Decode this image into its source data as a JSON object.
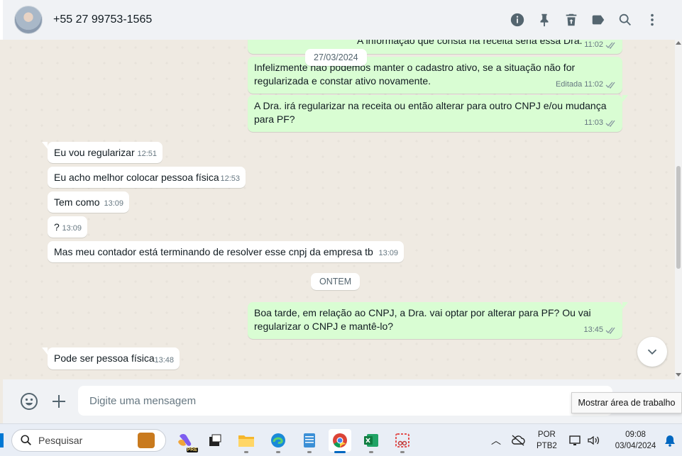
{
  "header": {
    "contact_name": "+55 27 99753-1565",
    "actions": [
      "info-icon",
      "pin-icon",
      "delete-icon",
      "label-icon",
      "search-icon",
      "menu-icon"
    ]
  },
  "chat": {
    "top_partial": {
      "text": "A informação que consta na receita seria essa Dra.",
      "time": "11:02"
    },
    "date_pill_1": "27/03/2024",
    "messages": [
      {
        "dir": "out",
        "text": "Infelizmente não podemos manter o cadastro ativo, se a situação não for regularizada e constar ativo novamente.",
        "edited": "Editada",
        "time": "11:02"
      },
      {
        "dir": "out",
        "text": "A Dra. irá regularizar na receita ou então alterar para outro CNPJ e/ou mudança para PF?",
        "time": "11:03"
      },
      {
        "dir": "in",
        "text": "Eu vou regularizar",
        "time": "12:51"
      },
      {
        "dir": "in",
        "text": "Eu acho melhor colocar pessoa física",
        "time": "12:53"
      },
      {
        "dir": "in",
        "text": "Tem como",
        "time": "13:09"
      },
      {
        "dir": "in",
        "text": "?",
        "time": "13:09"
      },
      {
        "dir": "in",
        "text": "Mas meu contador está terminando de resolver esse cnpj da empresa tb",
        "time": "13:09"
      },
      {
        "dir": "out",
        "text": "Boa tarde, em relação ao CNPJ, a Dra. vai optar por alterar para PF? Ou vai regularizar o CNPJ e mantê-lo?",
        "time": "13:45"
      },
      {
        "dir": "in",
        "text": "Pode ser pessoa física",
        "time": "13:48"
      }
    ],
    "date_pill_2": "ONTEM"
  },
  "composer": {
    "placeholder": "Digite uma mensagem"
  },
  "tooltip": "Mostrar área de trabalho",
  "taskbar": {
    "search_label": "Pesquisar",
    "copilot_badge": "PRE",
    "language": "POR",
    "layout": "PTB2",
    "time": "09:08",
    "date": "03/04/2024"
  },
  "colors": {
    "outgoing_bubble": "#d9fdd3",
    "incoming_bubble": "#ffffff",
    "chat_bg": "#efeae2",
    "read_ticks": "#53bdeb"
  }
}
